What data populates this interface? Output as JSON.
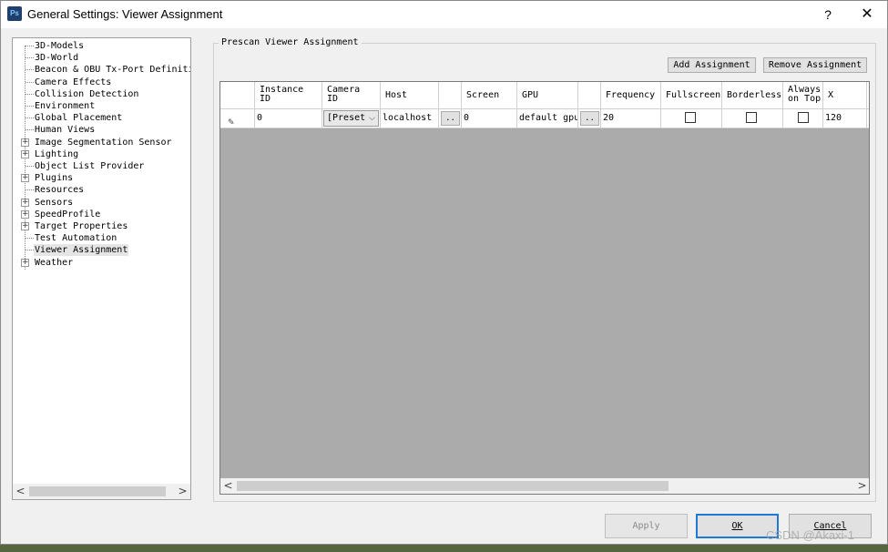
{
  "window": {
    "app_icon": "Ps",
    "title": "General Settings: Viewer Assignment",
    "help_label": "?",
    "close_label": "✕"
  },
  "tree": {
    "items": [
      {
        "label": "3D-Models",
        "expandable": false
      },
      {
        "label": "3D-World",
        "expandable": false
      },
      {
        "label": "Beacon & OBU Tx-Port Definitio",
        "expandable": false
      },
      {
        "label": "Camera Effects",
        "expandable": false
      },
      {
        "label": "Collision Detection",
        "expandable": false
      },
      {
        "label": "Environment",
        "expandable": false
      },
      {
        "label": "Global Placement",
        "expandable": false
      },
      {
        "label": "Human Views",
        "expandable": false
      },
      {
        "label": "Image Segmentation Sensor",
        "expandable": true
      },
      {
        "label": "Lighting",
        "expandable": true
      },
      {
        "label": "Object List Provider",
        "expandable": false
      },
      {
        "label": "Plugins",
        "expandable": true
      },
      {
        "label": "Resources",
        "expandable": false
      },
      {
        "label": "Sensors",
        "expandable": true
      },
      {
        "label": "SpeedProfile",
        "expandable": true
      },
      {
        "label": "Target Properties",
        "expandable": true
      },
      {
        "label": "Test Automation",
        "expandable": false
      },
      {
        "label": "Viewer Assignment",
        "expandable": false,
        "selected": true
      },
      {
        "label": "Weather",
        "expandable": true
      }
    ],
    "expander_symbol": "+",
    "scroll_left": "<",
    "scroll_right": ">"
  },
  "group": {
    "title": "Prescan Viewer Assignment",
    "add_label": "Add Assignment",
    "remove_label": "Remove Assignment"
  },
  "grid": {
    "columns": {
      "instance_id": [
        "Instance",
        "ID"
      ],
      "camera_id": [
        "Camera",
        "ID"
      ],
      "host": "Host",
      "screen": "Screen",
      "gpu": "GPU",
      "frequency": "Frequency",
      "fullscreen": "Fullscreen",
      "borderless": "Borderless",
      "always_on_top": [
        "Always",
        "on Top"
      ],
      "x": "X"
    },
    "row": {
      "instance_id": "0",
      "camera_id": "[Preset",
      "host": "localhost",
      "host_button": "..",
      "screen": "0",
      "gpu": "default gpu",
      "gpu_button": "..",
      "frequency": "20",
      "fullscreen": false,
      "borderless": false,
      "always_on_top": false,
      "x": "120",
      "overflow": ":"
    },
    "scroll_left": "<",
    "scroll_right": ">"
  },
  "buttons": {
    "apply": "Apply",
    "ok": "OK",
    "cancel": "Cancel"
  },
  "watermark": "CSDN @Akaxi-1"
}
